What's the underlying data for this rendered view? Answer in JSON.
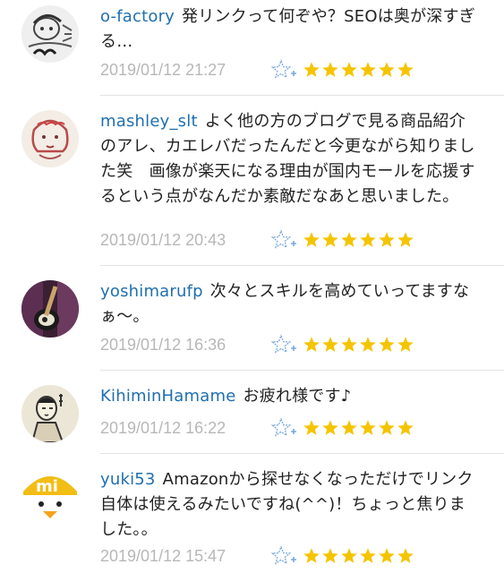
{
  "colors": {
    "username": "#1f6fb0",
    "text": "#222222",
    "timestamp": "#b7b7b7",
    "star": "#f5c400",
    "add_star": "#7aa8dd",
    "separator": "#e3e3e3"
  },
  "comments": [
    {
      "username": "o-factory",
      "text": "発リンクって何ぞや？SEOは奥が深すぎる…",
      "timestamp": "2019/01/12 21:27",
      "stars": 6,
      "avatar_icon": "sketch-portrait-icon"
    },
    {
      "username": "mashley_slt",
      "text": "よく他の方のブログで見る商品紹介のアレ、カエレバだったんだと今更ながら知りました笑　画像が楽天になる理由が国内モールを応援するという点がなんだか素敵だなあと思いました。",
      "timestamp": "2019/01/12 20:43",
      "stars": 6,
      "avatar_icon": "drawn-face-icon"
    },
    {
      "username": "yoshimarufp",
      "text": "次々とスキルを高めていってますなぁ〜。",
      "timestamp": "2019/01/12 16:36",
      "stars": 6,
      "avatar_icon": "guitar-photo-icon"
    },
    {
      "username": "KihiminHamame",
      "text": "お疲れ様です♪",
      "timestamp": "2019/01/12 16:22",
      "stars": 6,
      "avatar_icon": "ukiyoe-figure-icon"
    },
    {
      "username": "yuki53",
      "text": "Amazonから探せなくなっただけでリンク自体は使えるみたいですね(^^)！ちょっと焦りました。。",
      "timestamp": "2019/01/12 15:47",
      "stars": 6,
      "avatar_icon": "mi-chick-icon"
    }
  ]
}
